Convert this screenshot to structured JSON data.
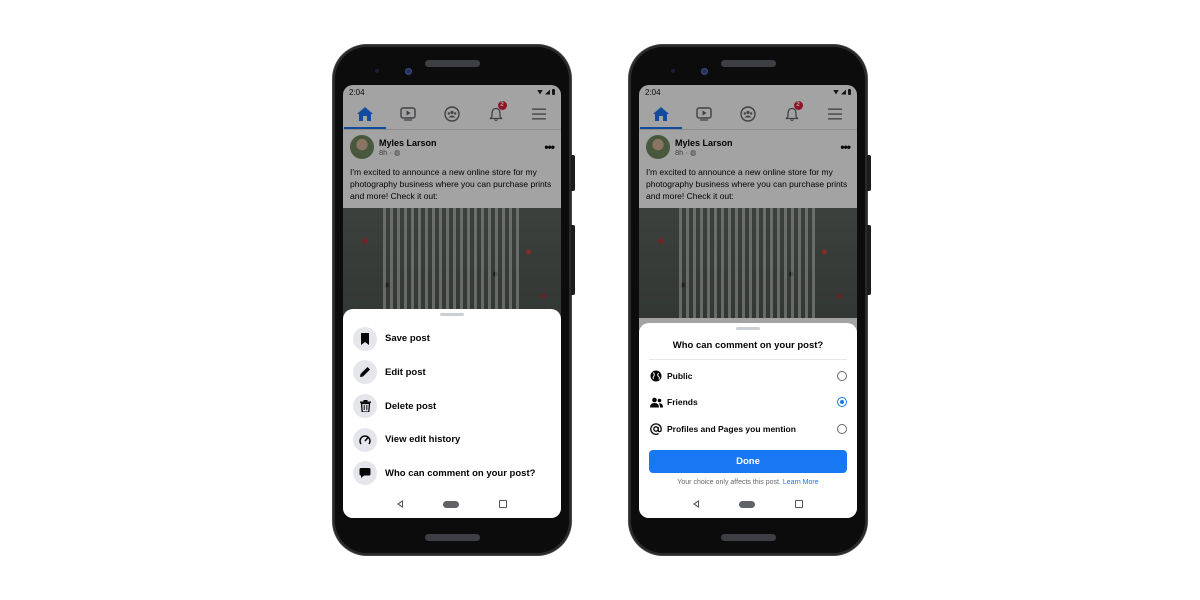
{
  "phones": [
    {
      "status_time": "2:04",
      "nav": {
        "items": [
          {
            "icon": "home-icon",
            "active": true
          },
          {
            "icon": "watch-icon",
            "active": false
          },
          {
            "icon": "groups-icon",
            "active": false
          },
          {
            "icon": "bell-icon",
            "active": false,
            "badge": "2"
          },
          {
            "icon": "menu-icon",
            "active": false
          }
        ]
      },
      "post": {
        "author": "Myles Larson",
        "time": "8h",
        "privacy_icon": "globe-icon",
        "text": "I'm excited to announce a new online store for my photography business where you can purchase prints and more! Check it out:"
      },
      "sheet": {
        "items": [
          {
            "label": "Save post",
            "icon": "bookmark-icon"
          },
          {
            "label": "Edit post",
            "icon": "pencil-icon"
          },
          {
            "label": "Delete post",
            "icon": "trash-icon"
          },
          {
            "label": "View edit history",
            "icon": "history-icon"
          },
          {
            "label": "Who can comment on your post?",
            "icon": "comment-icon"
          }
        ]
      }
    },
    {
      "status_time": "2:04",
      "nav": {
        "items": [
          {
            "icon": "home-icon",
            "active": true
          },
          {
            "icon": "watch-icon",
            "active": false
          },
          {
            "icon": "groups-icon",
            "active": false
          },
          {
            "icon": "bell-icon",
            "active": false,
            "badge": "2"
          },
          {
            "icon": "menu-icon",
            "active": false
          }
        ]
      },
      "post": {
        "author": "Myles Larson",
        "time": "8h",
        "privacy_icon": "globe-icon",
        "text": "I'm excited to announce a new online store for my photography business where you can purchase prints and more! Check it out:"
      },
      "dialog": {
        "title": "Who can comment on your post?",
        "options": [
          {
            "label": "Public",
            "icon": "globe-icon",
            "selected": false
          },
          {
            "label": "Friends",
            "icon": "friends-icon",
            "selected": true
          },
          {
            "label": "Profiles and Pages you mention",
            "icon": "at-icon",
            "selected": false
          }
        ],
        "done_label": "Done",
        "footnote": "Your choice only affects this post.",
        "learn_more": "Learn More"
      }
    }
  ],
  "colors": {
    "accent": "#1877f2",
    "badge": "#e41e3f"
  }
}
